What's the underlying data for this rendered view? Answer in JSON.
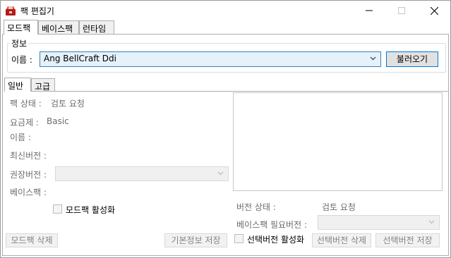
{
  "window": {
    "title": "팩 편집기",
    "controls": {
      "minimize": "minimize",
      "maximize": "maximize",
      "close": "close"
    }
  },
  "tabs": [
    {
      "label": "모드팩",
      "active": true
    },
    {
      "label": "베이스팩",
      "active": false
    },
    {
      "label": "런타임",
      "active": false
    }
  ],
  "info": {
    "group_label": "정보",
    "name_label": "이름 :",
    "name_value": "Ang BellCraft Ddi",
    "load_button": "불러오기"
  },
  "subtabs": [
    {
      "label": "일반",
      "active": true
    },
    {
      "label": "고급",
      "active": false
    }
  ],
  "general": {
    "pack_status_label": "팩 상태 :",
    "pack_status_value": "검토 요청",
    "plan_label": "요금제 :",
    "plan_value": "Basic",
    "name_label": "이름 :",
    "latest_version_label": "최신버전 :",
    "recommended_version_label": "권장버전 :",
    "basepack_label": "베이스팩 :",
    "modpack_enable_label": "모드팩 활성화",
    "version_status_label": "버전 상태 :",
    "version_status_value": "검토 요청",
    "basepack_required_label": "베이스팩 필요버전 :",
    "selected_version_enable_label": "선택버전 활성화"
  },
  "buttons": {
    "delete_modpack": "모드팩 삭제",
    "save_basic_info": "기본정보 저장",
    "delete_selected_version": "선택버전 삭제",
    "save_selected_version": "선택버전 저장"
  },
  "colors": {
    "focus_border": "#3c7fb1",
    "focus_fill": "#e5f1fb",
    "default_button_border": "#0078d7",
    "disabled_text": "#838383"
  }
}
